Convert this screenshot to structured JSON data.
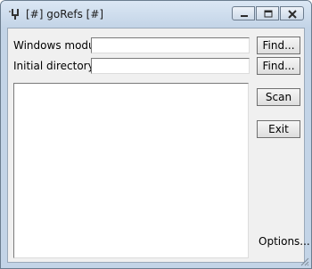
{
  "window": {
    "title": "[#] goRefs [#]",
    "icon": "tuning-fork-icon"
  },
  "titlebar_buttons": [
    "minimize-icon",
    "maximize-icon",
    "close-icon"
  ],
  "form": {
    "module_label": "Windows module",
    "module_value": "",
    "directory_label": "Initial directory",
    "directory_value": "",
    "find_label": "Find...",
    "scan_label": "Scan",
    "exit_label": "Exit",
    "options_label": "Options..."
  },
  "colors": {
    "frame": "#c3d4e7",
    "client_bg": "#f0f0f0",
    "close_hover": "#c7504a"
  }
}
